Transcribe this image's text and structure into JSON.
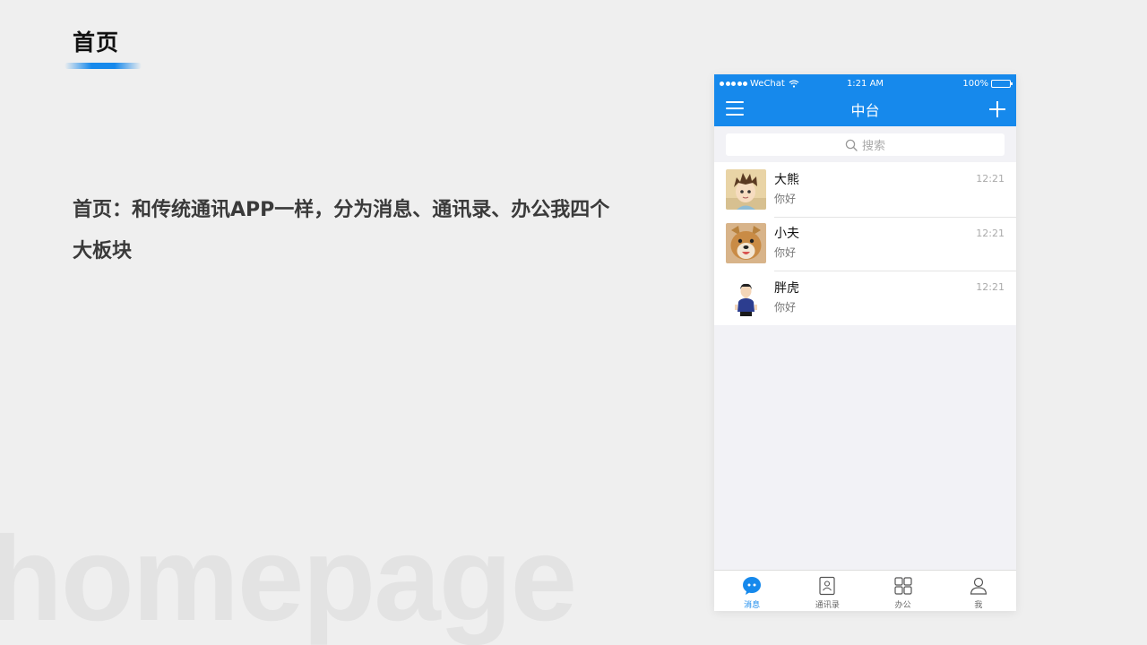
{
  "slide": {
    "title": "首页",
    "description": "首页：和传统通讯APP一样，分为消息、通讯录、办公我四个大板块",
    "watermark": "homepage",
    "accent_color": "#1689ec"
  },
  "phone": {
    "status_bar": {
      "carrier": "WeChat",
      "time": "1:21 AM",
      "battery": "100%",
      "icons": [
        "signal-dots-icon",
        "wifi-icon",
        "battery-icon"
      ]
    },
    "nav": {
      "title": "中台",
      "left_icon": "menu-icon",
      "right_icon": "plus-icon"
    },
    "search": {
      "placeholder": "搜索",
      "icon": "search-icon"
    },
    "chats": [
      {
        "name": "大熊",
        "message": "你好",
        "time": "12:21",
        "avatar": "cartoon-boy-avatar"
      },
      {
        "name": "小夫",
        "message": "你好",
        "time": "12:21",
        "avatar": "dog-avatar"
      },
      {
        "name": "胖虎",
        "message": "你好",
        "time": "12:21",
        "avatar": "person-illustration-avatar"
      }
    ],
    "tabs": [
      {
        "label": "消息",
        "icon": "chat-bubble-icon",
        "active": true
      },
      {
        "label": "通讯录",
        "icon": "contacts-book-icon",
        "active": false
      },
      {
        "label": "办公",
        "icon": "grid-apps-icon",
        "active": false
      },
      {
        "label": "我",
        "icon": "person-icon",
        "active": false
      }
    ]
  }
}
